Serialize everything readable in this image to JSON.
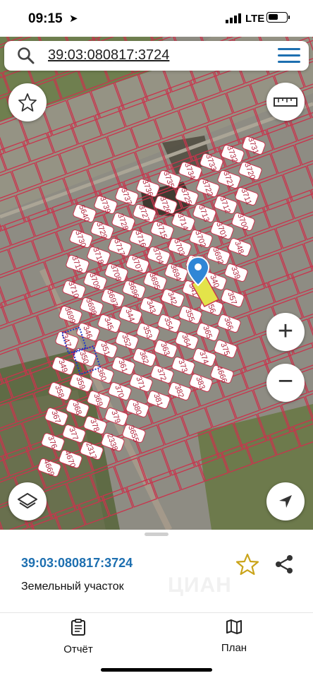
{
  "status_bar": {
    "time": "09:15",
    "network": "LTE",
    "battery_level": 0.55
  },
  "search": {
    "cadastral_number": "39:03:080817:3724"
  },
  "map": {
    "parcel_labels": [
      "5640",
      "3739",
      "3737",
      "3736",
      "3735",
      "3734",
      "3733",
      "3732",
      "3731",
      "3730",
      "3729",
      "3728",
      "3727",
      "3726",
      "3725",
      "3722",
      "3721",
      "3720",
      "3719",
      "3718",
      "3717",
      "3716",
      "3715",
      "3714",
      "3713",
      "3712",
      "3711",
      "3710",
      "3709",
      "3708",
      "3707",
      "3704",
      "3703",
      "3702",
      "3701",
      "3700",
      "3699",
      "3698",
      "3697",
      "3696",
      "3695",
      "3694",
      "3693",
      "3692",
      "348",
      "347",
      "346",
      "345",
      "344",
      "343",
      "342",
      "341",
      "340",
      "339",
      "349",
      "350",
      "351",
      "352",
      "353",
      "354",
      "355",
      "356",
      "357",
      "358",
      "359",
      "360",
      "361",
      "362",
      "363",
      "364",
      "365",
      "366",
      "367",
      "368",
      "369",
      "370",
      "371",
      "372",
      "373",
      "374",
      "375",
      "376",
      "377",
      "378",
      "379",
      "380",
      "381",
      "382",
      "383",
      "4666",
      "4669",
      "4670",
      "2317",
      "2338",
      "3655"
    ],
    "selected_parcel_color": "#e3e34a",
    "parcel_border_color": "#c9344d",
    "marker_color": "#2f86d6"
  },
  "controls": {
    "favorite_icon": "star-icon",
    "ruler_icon": "ruler-icon",
    "zoom_in": "+",
    "zoom_out": "−",
    "layers_icon": "layers-icon",
    "locate_icon": "navigation-arrow-icon"
  },
  "bottom_sheet": {
    "cadastral_number": "39:03:080817:3724",
    "property_type": "Земельный участок",
    "watermark": "ЦИАН",
    "tabs": [
      {
        "label": "Отчёт",
        "icon": "report-icon"
      },
      {
        "label": "План",
        "icon": "map-icon"
      }
    ]
  }
}
